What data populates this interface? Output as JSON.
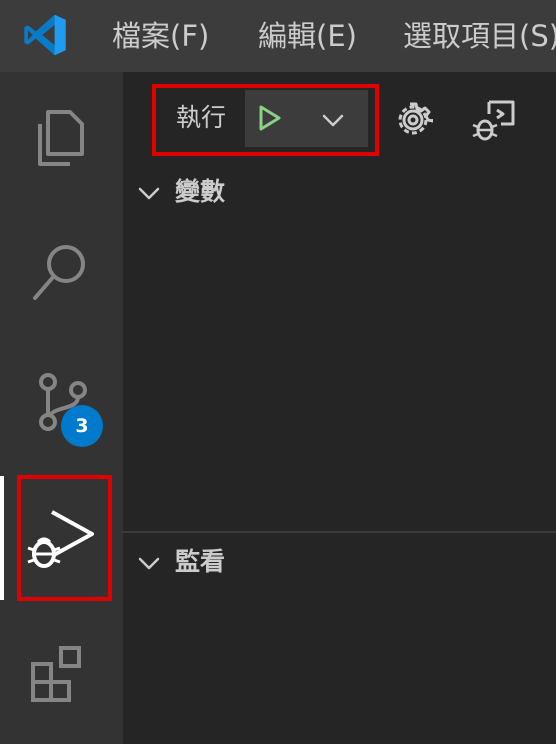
{
  "menubar": {
    "app_icon": "vscode-logo",
    "items": [
      {
        "label": "檔案(F)"
      },
      {
        "label": "編輯(E)"
      },
      {
        "label": "選取項目(S)"
      }
    ]
  },
  "activity_bar": {
    "items": [
      {
        "id": "explorer",
        "icon": "files-icon"
      },
      {
        "id": "search",
        "icon": "search-icon"
      },
      {
        "id": "source-control",
        "icon": "source-control-icon",
        "badge": "3"
      },
      {
        "id": "run-debug",
        "icon": "run-debug-icon",
        "active": true
      },
      {
        "id": "extensions",
        "icon": "extensions-icon"
      }
    ]
  },
  "debug_toolbar": {
    "run_label": "執行",
    "start_icon": "play-icon",
    "config_dropdown_icon": "chevron-down-icon",
    "settings_icon": "gear-icon",
    "debug_console_icon": "debug-console-icon"
  },
  "sections": {
    "variables": {
      "title": "變數",
      "expanded": true
    },
    "watch": {
      "title": "監看",
      "expanded": true
    }
  },
  "colors": {
    "accent_blue": "#007acc",
    "play_green": "#89d185",
    "highlight_red": "#e00000",
    "titlebar_bg": "#3c3c3c",
    "activitybar_bg": "#333333",
    "sidebar_bg": "#252526"
  }
}
